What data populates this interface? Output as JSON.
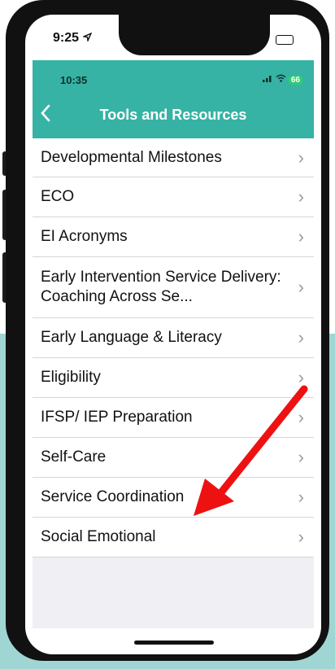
{
  "outer_status": {
    "time": "9:25",
    "location_icon": "location-arrow-icon",
    "signal_icon": "signal-icon",
    "wifi_icon": "wifi-icon",
    "battery_icon": "battery-icon"
  },
  "inner_status": {
    "time": "10:35",
    "battery_level": "66"
  },
  "header": {
    "title": "Tools and Resources",
    "back_icon": "chevron-left-icon",
    "color": "#36b3a4"
  },
  "list": {
    "items": [
      {
        "label": "Developmental Milestones"
      },
      {
        "label": "ECO"
      },
      {
        "label": "EI Acronyms"
      },
      {
        "label": "Early Intervention Service Delivery: Coaching Across Se..."
      },
      {
        "label": "Early Language & Literacy"
      },
      {
        "label": "Eligibility"
      },
      {
        "label": "IFSP/ IEP Preparation"
      },
      {
        "label": "Self-Care"
      },
      {
        "label": "Service Coordination"
      },
      {
        "label": "Social Emotional"
      }
    ],
    "chevron_icon": "chevron-right-icon"
  },
  "annotation": {
    "type": "arrow",
    "color": "#ee1111",
    "points_to": "Social Emotional"
  },
  "colors": {
    "background_band": "#9fd6d4"
  }
}
